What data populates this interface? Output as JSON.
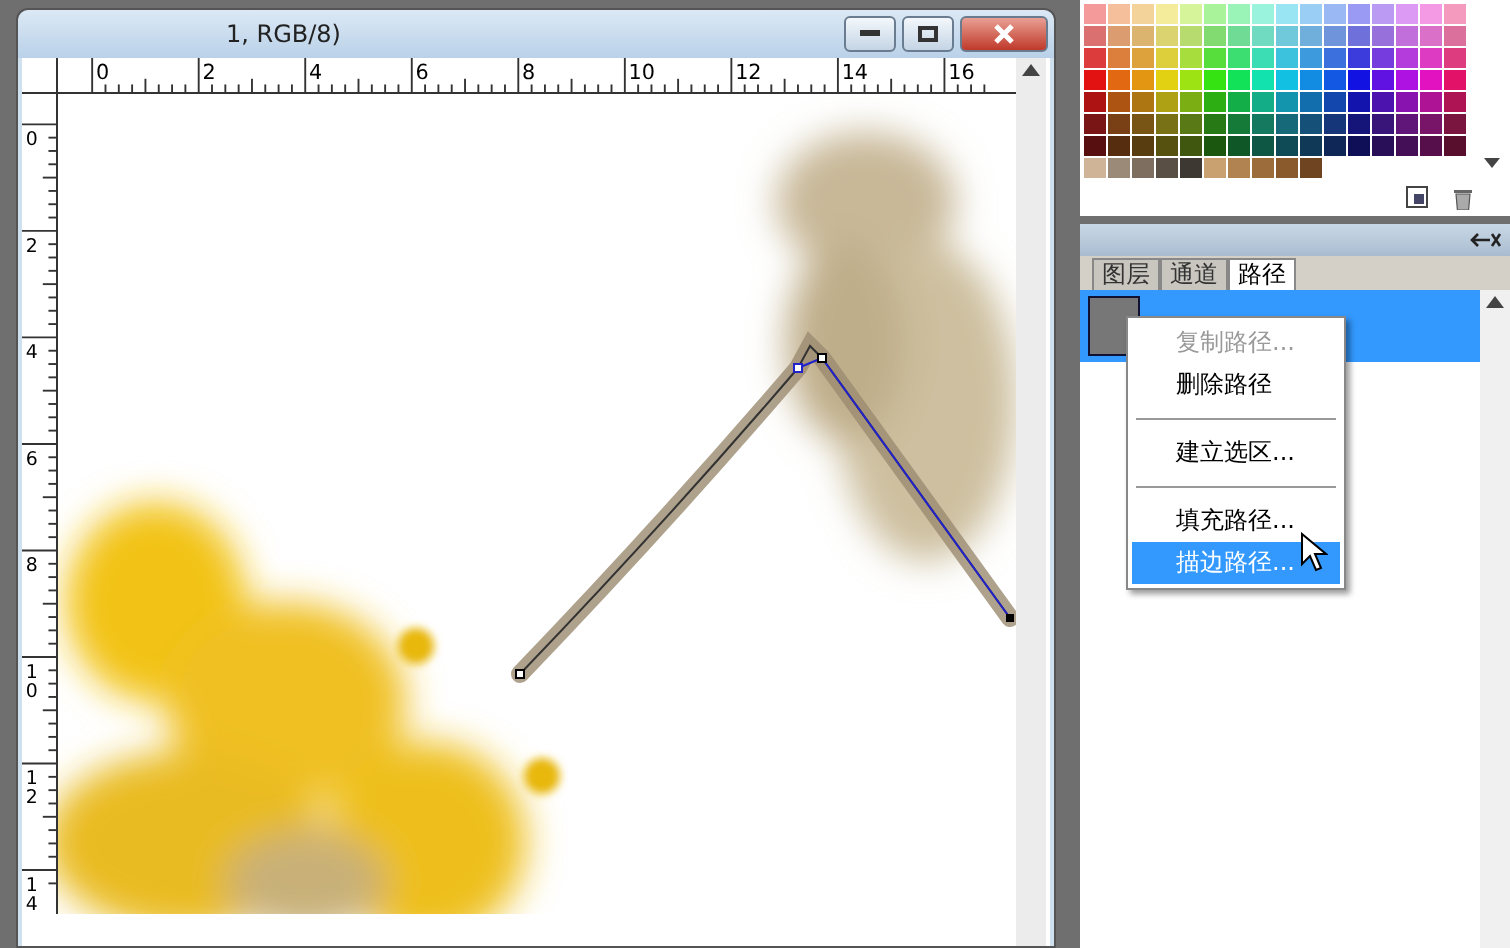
{
  "document": {
    "title": "1, RGB/8)",
    "ruler_h": [
      "0",
      "2",
      "4",
      "6",
      "8",
      "10",
      "12",
      "14",
      "16"
    ],
    "ruler_v": [
      "0",
      "2",
      "4",
      "6",
      "8",
      "10",
      "12",
      "14"
    ]
  },
  "panel": {
    "tabs": [
      {
        "label": "图层",
        "selected": false
      },
      {
        "label": "通道",
        "selected": false
      },
      {
        "label": "路径",
        "selected": true
      }
    ],
    "paths": [
      {
        "selected": true
      }
    ]
  },
  "context_menu": [
    {
      "kind": "item",
      "label": "复制路径...",
      "disabled": true,
      "selected": false
    },
    {
      "kind": "item",
      "label": "删除路径",
      "disabled": false,
      "selected": false
    },
    {
      "kind": "separator"
    },
    {
      "kind": "item",
      "label": "建立选区...",
      "disabled": false,
      "selected": false
    },
    {
      "kind": "separator"
    },
    {
      "kind": "item",
      "label": "填充路径...",
      "disabled": false,
      "selected": false
    },
    {
      "kind": "item",
      "label": "描边路径...",
      "disabled": false,
      "selected": true
    }
  ]
}
